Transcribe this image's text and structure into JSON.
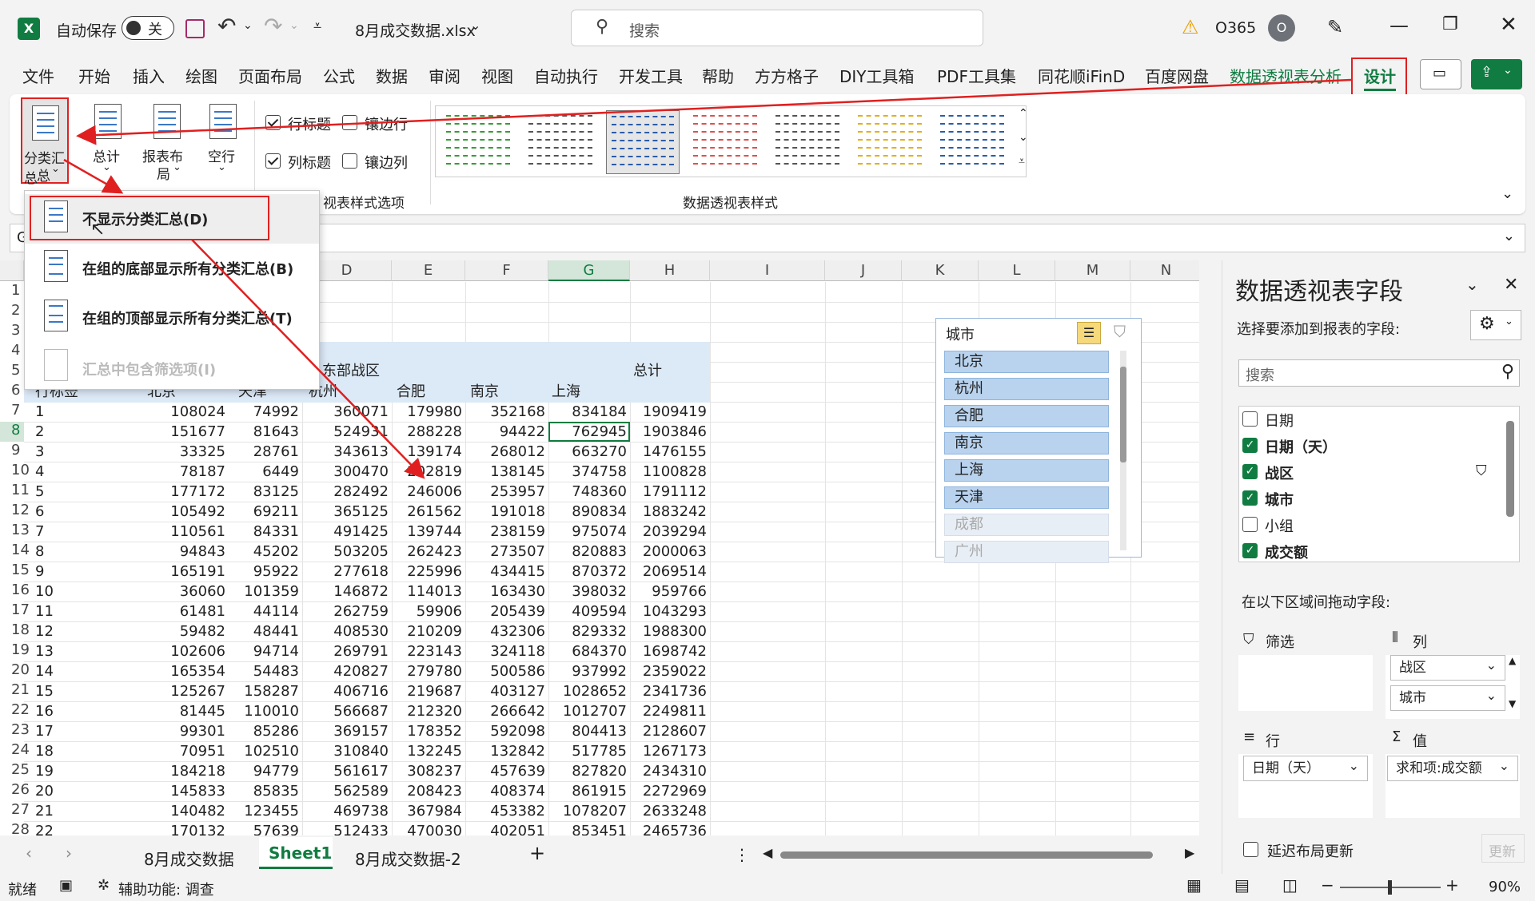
{
  "titlebar": {
    "autosave_label": "自动保存",
    "autosave_state": "关",
    "filename": "8月成交数据.xlsx",
    "search_placeholder": "搜索",
    "account": "O365",
    "avatar_letter": "O"
  },
  "tabs": [
    "文件",
    "开始",
    "插入",
    "绘图",
    "页面布局",
    "公式",
    "数据",
    "审阅",
    "视图",
    "自动执行",
    "开发工具",
    "帮助",
    "方方格子",
    "DIY工具箱",
    "PDF工具集",
    "同花顺iFinD",
    "百度网盘",
    "数据透视表分析",
    "设计"
  ],
  "ribbon": {
    "subtotal": "分类汇总",
    "subtotal2": "总",
    "grandtotal": "总计",
    "report_layout": "报表布",
    "report_layout2": "局",
    "blank_rows": "空行",
    "row_headers": "行标题",
    "banded_rows": "镶边行",
    "col_headers": "列标题",
    "banded_cols": "镶边列",
    "group_style_options": "视表样式选项",
    "group_styles": "数据透视表样式"
  },
  "formula": {
    "namebox": "G"
  },
  "subtotal_menu": [
    {
      "label": "不显示分类汇总(D)",
      "enabled": true
    },
    {
      "label": "在组的底部显示所有分类汇总(B)",
      "enabled": true
    },
    {
      "label": "在组的顶部显示所有分类汇总(T)",
      "enabled": true
    },
    {
      "label": "汇总中包含筛选项(I)",
      "enabled": false
    }
  ],
  "sheet": {
    "columns": [
      "D",
      "E",
      "F",
      "G",
      "H",
      "I",
      "J",
      "K",
      "L",
      "M",
      "N"
    ],
    "row_numbers": [
      "1",
      "2",
      "3",
      "4",
      "5",
      "6",
      "7",
      "8",
      "9",
      "10",
      "11",
      "12",
      "13",
      "14",
      "15",
      "16",
      "17",
      "18",
      "19",
      "20",
      "21",
      "22",
      "23",
      "24",
      "25",
      "26",
      "27",
      "28"
    ],
    "header_row5": {
      "region": "东部战区",
      "total": "总计"
    },
    "header_row6": {
      "rowlabel": "行标签",
      "c1": "北京",
      "c2": "天津",
      "c3": "杭州",
      "c4": "合肥",
      "c5": "南京",
      "c6": "上海"
    },
    "rows": [
      [
        "1",
        "108024",
        "74992",
        "360071",
        "179980",
        "352168",
        "834184",
        "1909419"
      ],
      [
        "2",
        "151677",
        "81643",
        "524931",
        "288228",
        "94422",
        "762945",
        "1903846"
      ],
      [
        "3",
        "33325",
        "28761",
        "343613",
        "139174",
        "268012",
        "663270",
        "1476155"
      ],
      [
        "4",
        "78187",
        "6449",
        "300470",
        "202819",
        "138145",
        "374758",
        "1100828"
      ],
      [
        "5",
        "177172",
        "83125",
        "282492",
        "246006",
        "253957",
        "748360",
        "1791112"
      ],
      [
        "6",
        "105492",
        "69211",
        "365125",
        "261562",
        "191018",
        "890834",
        "1883242"
      ],
      [
        "7",
        "110561",
        "84331",
        "491425",
        "139744",
        "238159",
        "975074",
        "2039294"
      ],
      [
        "8",
        "94843",
        "45202",
        "503205",
        "262423",
        "273507",
        "820883",
        "2000063"
      ],
      [
        "9",
        "165191",
        "95922",
        "277618",
        "225996",
        "434415",
        "870372",
        "2069514"
      ],
      [
        "10",
        "36060",
        "101359",
        "146872",
        "114013",
        "163430",
        "398032",
        "959766"
      ],
      [
        "11",
        "61481",
        "44114",
        "262759",
        "59906",
        "205439",
        "409594",
        "1043293"
      ],
      [
        "12",
        "59482",
        "48441",
        "408530",
        "210209",
        "432306",
        "829332",
        "1988300"
      ],
      [
        "13",
        "102606",
        "94714",
        "269791",
        "223143",
        "324118",
        "684370",
        "1698742"
      ],
      [
        "14",
        "165354",
        "54483",
        "420827",
        "279780",
        "500586",
        "937992",
        "2359022"
      ],
      [
        "15",
        "125267",
        "158287",
        "406716",
        "219687",
        "403127",
        "1028652",
        "2341736"
      ],
      [
        "16",
        "81445",
        "110010",
        "566687",
        "212320",
        "266642",
        "1012707",
        "2249811"
      ],
      [
        "17",
        "99301",
        "85286",
        "369157",
        "178352",
        "592098",
        "804413",
        "2128607"
      ],
      [
        "18",
        "70951",
        "102510",
        "310840",
        "132245",
        "132842",
        "517785",
        "1267173"
      ],
      [
        "19",
        "184218",
        "94779",
        "561617",
        "308237",
        "457639",
        "827820",
        "2434310"
      ],
      [
        "20",
        "145833",
        "85835",
        "562589",
        "208423",
        "408374",
        "861915",
        "2272969"
      ],
      [
        "21",
        "140482",
        "123455",
        "469738",
        "367984",
        "453382",
        "1078207",
        "2633248"
      ],
      [
        "22",
        "170132",
        "57639",
        "512433",
        "470030",
        "402051",
        "853451",
        "2465736"
      ]
    ]
  },
  "slicer": {
    "title": "城市",
    "items": [
      {
        "label": "北京",
        "on": true
      },
      {
        "label": "杭州",
        "on": true
      },
      {
        "label": "合肥",
        "on": true
      },
      {
        "label": "南京",
        "on": true
      },
      {
        "label": "上海",
        "on": true
      },
      {
        "label": "天津",
        "on": true
      },
      {
        "label": "成都",
        "on": false
      },
      {
        "label": "广州",
        "on": false
      }
    ]
  },
  "sheet_tabs": [
    "8月成交数据",
    "Sheet1",
    "8月成交数据-2"
  ],
  "pane": {
    "title": "数据透视表字段",
    "subtitle": "选择要添加到报表的字段:",
    "search_placeholder": "搜索",
    "fields": [
      {
        "label": "日期",
        "checked": false
      },
      {
        "label": "日期（天）",
        "checked": true
      },
      {
        "label": "战区",
        "checked": true
      },
      {
        "label": "城市",
        "checked": true
      },
      {
        "label": "小组",
        "checked": false
      },
      {
        "label": "成交额",
        "checked": true
      }
    ],
    "drag_label": "在以下区域间拖动字段:",
    "filter_label": "筛选",
    "columns_label": "列",
    "rows_label": "行",
    "values_label": "值",
    "col_items": [
      "战区",
      "城市"
    ],
    "row_item": "日期（天）",
    "value_item": "求和项:成交额",
    "defer_label": "延迟布局更新",
    "update_label": "更新"
  },
  "status": {
    "ready": "就绪",
    "accessibility": "辅助功能: 调查",
    "zoom": "90%"
  },
  "colors": {
    "excel_green": "#107c41",
    "annotation_red": "#e02020",
    "header_fill": "#dce9f6"
  }
}
